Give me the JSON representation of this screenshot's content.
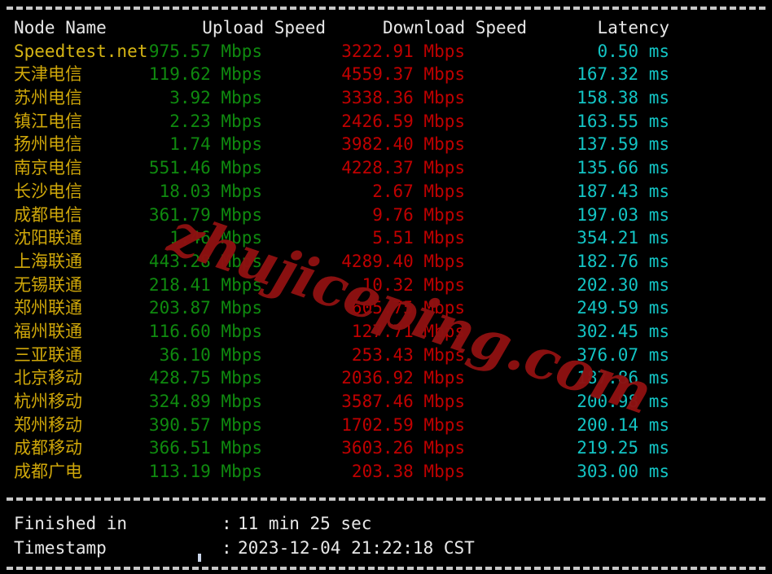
{
  "terminal": {
    "separator_top": "dashed-rule",
    "separator_middle": "dashed-rule",
    "separator_bottom": "dashed-rule",
    "cursor": "block-cursor"
  },
  "colors": {
    "background": "#000000",
    "header_text": "#e8e8e8",
    "node_name": "#cfa70a",
    "upload": "#0f8a0f",
    "download": "#c00000",
    "latency": "#13c4c4",
    "watermark": "#8e1111"
  },
  "watermark": {
    "text": "zhujiceping.com"
  },
  "table": {
    "headers": {
      "node": "Node Name",
      "upload": "Upload Speed",
      "download": "Download Speed",
      "latency": "Latency"
    },
    "rows": [
      {
        "node": "Speedtest.net",
        "upload": "975.57 Mbps",
        "download": "3222.91 Mbps",
        "latency": "0.50 ms"
      },
      {
        "node": "天津电信",
        "upload": "119.62 Mbps",
        "download": "4559.37 Mbps",
        "latency": "167.32 ms"
      },
      {
        "node": "苏州电信",
        "upload": "3.92 Mbps",
        "download": "3338.36 Mbps",
        "latency": "158.38 ms"
      },
      {
        "node": "镇江电信",
        "upload": "2.23 Mbps",
        "download": "2426.59 Mbps",
        "latency": "163.55 ms"
      },
      {
        "node": "扬州电信",
        "upload": "1.74 Mbps",
        "download": "3982.40 Mbps",
        "latency": "137.59 ms"
      },
      {
        "node": "南京电信",
        "upload": "551.46 Mbps",
        "download": "4228.37 Mbps",
        "latency": "135.66 ms"
      },
      {
        "node": "长沙电信",
        "upload": "18.03 Mbps",
        "download": "2.67 Mbps",
        "latency": "187.43 ms"
      },
      {
        "node": "成都电信",
        "upload": "361.79 Mbps",
        "download": "9.76 Mbps",
        "latency": "197.03 ms"
      },
      {
        "node": "沈阳联通",
        "upload": "1.46 Mbps",
        "download": "5.51 Mbps",
        "latency": "354.21 ms"
      },
      {
        "node": "上海联通",
        "upload": "443.28 Mbps",
        "download": "4289.40 Mbps",
        "latency": "182.76 ms"
      },
      {
        "node": "无锡联通",
        "upload": "218.41 Mbps",
        "download": "10.32 Mbps",
        "latency": "202.30 ms"
      },
      {
        "node": "郑州联通",
        "upload": "203.87 Mbps",
        "download": "605.75 Mbps",
        "latency": "249.59 ms"
      },
      {
        "node": "福州联通",
        "upload": "116.60 Mbps",
        "download": "127.71 Mbps",
        "latency": "302.45 ms"
      },
      {
        "node": "三亚联通",
        "upload": "36.10 Mbps",
        "download": "253.43 Mbps",
        "latency": "376.07 ms"
      },
      {
        "node": "北京移动",
        "upload": "428.75 Mbps",
        "download": "2036.92 Mbps",
        "latency": "187.86 ms"
      },
      {
        "node": "杭州移动",
        "upload": "324.89 Mbps",
        "download": "3587.46 Mbps",
        "latency": "200.98 ms"
      },
      {
        "node": "郑州移动",
        "upload": "390.57 Mbps",
        "download": "1702.59 Mbps",
        "latency": "200.14 ms"
      },
      {
        "node": "成都移动",
        "upload": "366.51 Mbps",
        "download": "3603.26 Mbps",
        "latency": "219.25 ms"
      },
      {
        "node": "成都广电",
        "upload": "113.19 Mbps",
        "download": "203.38 Mbps",
        "latency": "303.00 ms"
      }
    ]
  },
  "summary": {
    "finished_label": "Finished in",
    "finished_colon": ":",
    "finished_value": "11 min 25 sec",
    "timestamp_label": "Timestamp",
    "timestamp_colon": ":",
    "timestamp_value": "2023-12-04 21:22:18 CST"
  }
}
